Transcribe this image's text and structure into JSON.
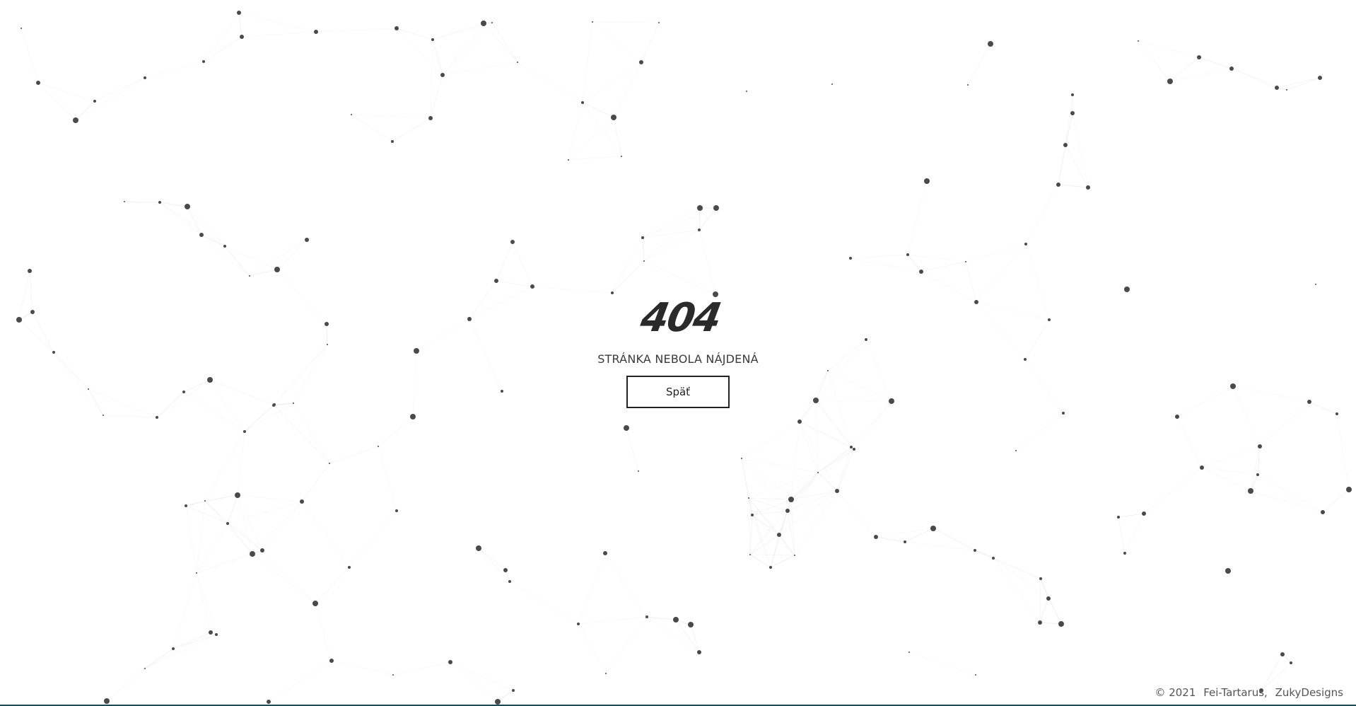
{
  "error": {
    "code": "404",
    "message": "STRÁNKA NEBOLA NÁJDENÁ",
    "back_label": "Späť"
  },
  "footer": {
    "copyright": "© 2021",
    "author_1": "Fei-Tartarus,",
    "author_2": "ZukyDesigns"
  },
  "colors": {
    "background": "#ffffff",
    "particle": "#4a4a4a",
    "link": "#e6e6e6",
    "text": "#2a2a2a"
  }
}
